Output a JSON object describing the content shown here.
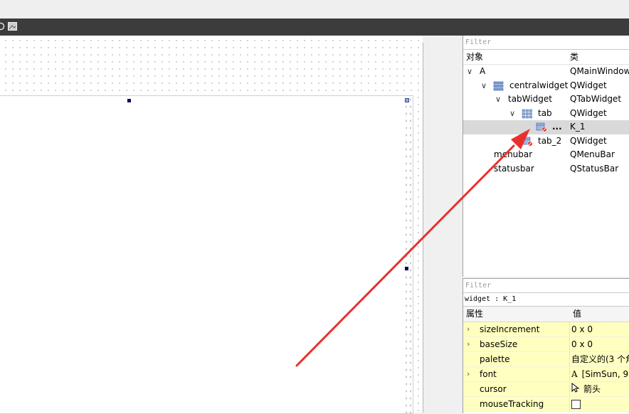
{
  "object_inspector": {
    "filter_placeholder": "Filter",
    "columns": {
      "object": "对象",
      "class": "类"
    },
    "rows": [
      {
        "name": "A",
        "class": "QMainWindow",
        "chev": "∨"
      },
      {
        "name": "centralwidget",
        "class": "QWidget",
        "chev": "∨"
      },
      {
        "name": "tabWidget",
        "class": "QTabWidget",
        "chev": "∨"
      },
      {
        "name": "tab",
        "class": "QWidget",
        "chev": "∨"
      },
      {
        "name": "...",
        "class": "K_1",
        "chev": ""
      },
      {
        "name": "tab_2",
        "class": "QWidget",
        "chev": ""
      },
      {
        "name": "menubar",
        "class": "QMenuBar",
        "chev": ""
      },
      {
        "name": "statusbar",
        "class": "QStatusBar",
        "chev": ""
      }
    ]
  },
  "property_editor": {
    "filter_placeholder": "Filter",
    "title": "widget : K_1",
    "columns": {
      "property": "属性",
      "value": "值"
    },
    "rows": [
      {
        "name": "sizeIncrement",
        "value": "0 x 0",
        "expandable": "›"
      },
      {
        "name": "baseSize",
        "value": "0 x 0",
        "expandable": "›"
      },
      {
        "name": "palette",
        "value": "自定义的(3 个角",
        "expandable": ""
      },
      {
        "name": "font",
        "value": "[SimSun, 9",
        "expandable": "›",
        "icon": "A"
      },
      {
        "name": "cursor",
        "value": "箭头",
        "expandable": ""
      },
      {
        "name": "mouseTracking",
        "value": "",
        "expandable": ""
      }
    ]
  },
  "colors": {
    "toolbar": "#3c3c3c",
    "property_row": "#ffffc0",
    "selection": "#d9d9d9",
    "annotation_arrow": "#e8312f"
  }
}
